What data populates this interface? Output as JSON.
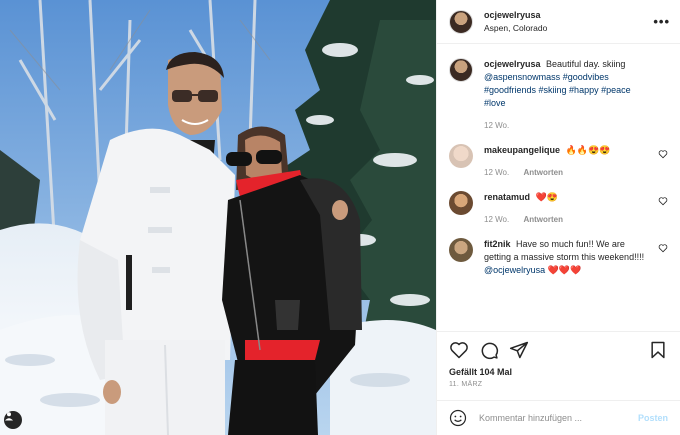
{
  "post": {
    "username": "ocjewelryusa",
    "location": "Aspen, Colorado",
    "caption": {
      "user": "ocjewelryusa",
      "text_start": "Beautiful day. skiing",
      "mention": "@aspensnowmass",
      "hashtags": "#goodvibes #goodfriends #skiing #happy #peace #love",
      "time": "12 Wo."
    },
    "comments": [
      {
        "user": "makeupangelique",
        "text": "🔥🔥😍😍",
        "time": "12 Wo.",
        "reply": "Antworten"
      },
      {
        "user": "renatamud",
        "text": "❤️😍",
        "time": "12 Wo.",
        "reply": "Antworten"
      },
      {
        "user": "fit2nik",
        "text": "Have so much fun!! We are getting a massive storm this weekend!!!! ",
        "mention": "@ocjewelryusa",
        "emoji": "❤️❤️❤️"
      }
    ],
    "likes": "Gefällt 104 Mal",
    "date": "11. MÄRZ",
    "comment_placeholder": "Kommentar hinzufügen ...",
    "post_label": "Posten"
  },
  "icons": {
    "more": "more-icon",
    "heart": "heart-icon",
    "comment": "comment-icon",
    "share": "share-icon",
    "save": "bookmark-icon",
    "emoji": "emoji-icon",
    "tag": "user-tag-icon"
  },
  "colors": {
    "link": "#00376b",
    "muted": "#8e8e8e",
    "post_disabled": "#b2dffc"
  }
}
